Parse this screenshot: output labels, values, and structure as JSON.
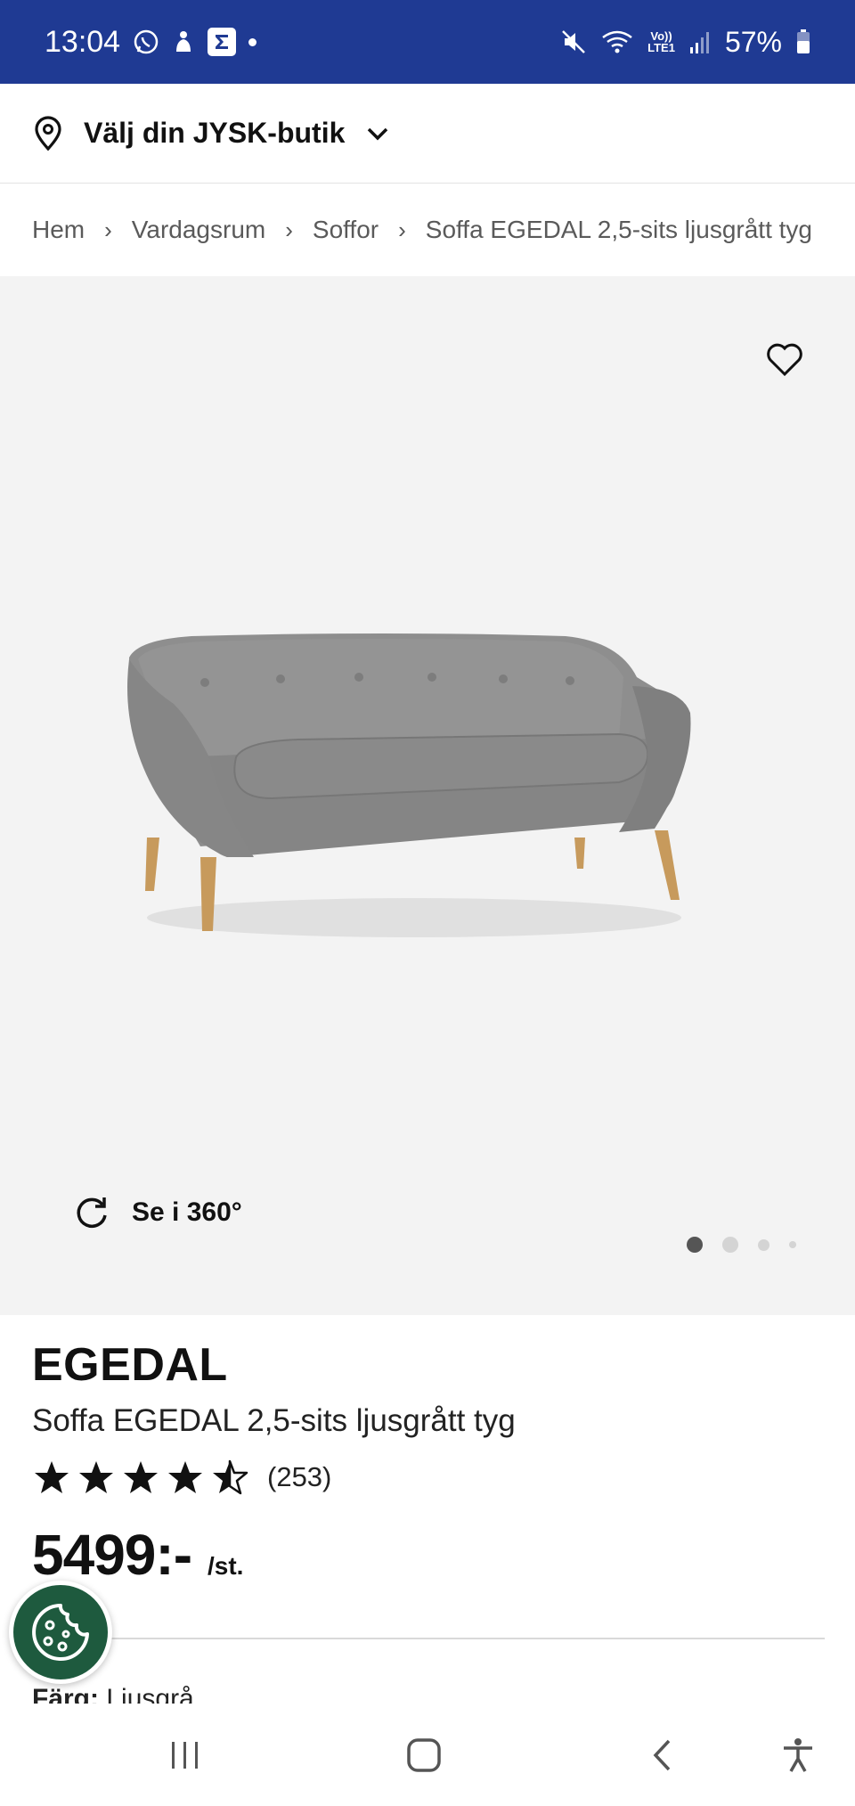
{
  "status_bar": {
    "time": "13:04",
    "battery": "57%",
    "network": "LTE1",
    "icons": [
      "whatsapp-icon",
      "notification-icon",
      "sigma-app-icon",
      "mute-icon",
      "wifi-icon",
      "signal-icon",
      "battery-icon"
    ]
  },
  "store": {
    "label": "Välj din JYSK-butik",
    "icon": "location-pin-icon"
  },
  "breadcrumb": {
    "items": [
      "Hem",
      "Vardagsrum",
      "Soffor",
      "Soffa EGEDAL 2,5-sits ljusgrått tyg"
    ],
    "separator": "›"
  },
  "gallery": {
    "view_360_label": "Se i 360°",
    "image_count": 4,
    "active_index": 0
  },
  "product": {
    "brand": "EGEDAL",
    "name": "Soffa EGEDAL 2,5-sits ljusgrått tyg",
    "rating": 4.5,
    "rating_max": 5,
    "review_count": "(253)",
    "price": "5499:-",
    "price_unit": "/st.",
    "color_label": "Färg:",
    "color_value": "Ljusgrå"
  },
  "colors": {
    "status_bar_bg": "#1f3a93",
    "gallery_bg": "#f3f3f3",
    "cookie_bg": "#1e5a3e",
    "sofa_fabric": "#8e8e8e",
    "sofa_legs": "#c79a5c"
  }
}
